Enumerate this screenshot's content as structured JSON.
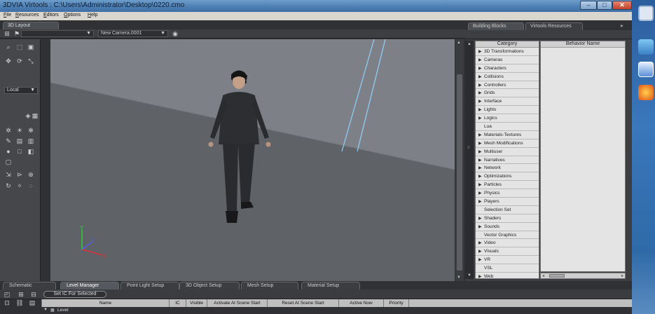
{
  "window": {
    "title": "3DVIA Virtools : C:\\Users\\Administrator\\Desktop\\0220.cmo"
  },
  "menu": [
    "File",
    "Resources",
    "Editors",
    "Options",
    "Help"
  ],
  "left_tab": "3D Layout",
  "toolbar": {
    "camera_select": "New Camera.0001"
  },
  "tools": {
    "reference_select": "Local"
  },
  "right_tabs": [
    "Building Blocks",
    "Virtools Resources"
  ],
  "building_blocks": {
    "col_category": "Category",
    "col_behavior": "Behavior Name",
    "categories": [
      {
        "label": "3D Transformations",
        "expandable": true
      },
      {
        "label": "Cameras",
        "expandable": true
      },
      {
        "label": "Characters",
        "expandable": true
      },
      {
        "label": "Collisions",
        "expandable": true
      },
      {
        "label": "Controllers",
        "expandable": true
      },
      {
        "label": "Grids",
        "expandable": true
      },
      {
        "label": "Interface",
        "expandable": true
      },
      {
        "label": "Lights",
        "expandable": true
      },
      {
        "label": "Logics",
        "expandable": true
      },
      {
        "label": "Lua",
        "expandable": false
      },
      {
        "label": "Materials-Textures",
        "expandable": true
      },
      {
        "label": "Mesh Modifications",
        "expandable": true
      },
      {
        "label": "Multiuser",
        "expandable": true
      },
      {
        "label": "Narratives",
        "expandable": true
      },
      {
        "label": "Network",
        "expandable": true
      },
      {
        "label": "Optimizations",
        "expandable": true
      },
      {
        "label": "Particles",
        "expandable": true
      },
      {
        "label": "Physics",
        "expandable": true
      },
      {
        "label": "Players",
        "expandable": true
      },
      {
        "label": "Selection Set",
        "expandable": false
      },
      {
        "label": "Shaders",
        "expandable": true
      },
      {
        "label": "Sounds",
        "expandable": true
      },
      {
        "label": "Vector Graphics",
        "expandable": false
      },
      {
        "label": "Video",
        "expandable": true
      },
      {
        "label": "Visuals",
        "expandable": true
      },
      {
        "label": "VR",
        "expandable": true
      },
      {
        "label": "VSL",
        "expandable": false
      },
      {
        "label": "Web",
        "expandable": true
      }
    ]
  },
  "bottom_tabs": [
    {
      "label": "Schematic",
      "active": false
    },
    {
      "label": "Level Manager",
      "active": true
    },
    {
      "label": "Point Light Setup",
      "active": false
    },
    {
      "label": "3D Object Setup",
      "active": false
    },
    {
      "label": "Mesh Setup",
      "active": false
    },
    {
      "label": "Material Setup",
      "active": false
    }
  ],
  "level_manager": {
    "set_ic_button": "Set IC For Selected",
    "columns": [
      "Name",
      "IC",
      "Visible",
      "Activate At Scene Start",
      "Reset At Scene Start",
      "Active Now",
      "Priority"
    ],
    "root_item": "Level"
  },
  "colors": {
    "viewport_bg": "#7b7e84",
    "floor": "#5f6267",
    "axis_x": "#e0303a",
    "axis_y": "#30d040",
    "axis_z": "#5060e8"
  },
  "icons": [
    "search-icon",
    "camera-icon",
    "move-icon",
    "rotate-icon",
    "scale-icon",
    "light-icon"
  ]
}
